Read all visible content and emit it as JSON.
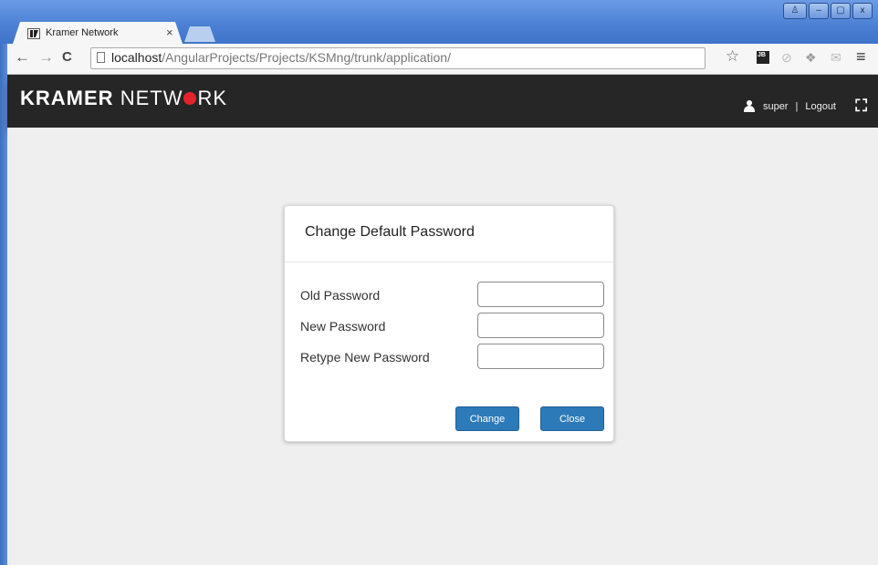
{
  "browser": {
    "tab_title": "Kramer Network",
    "tab_close": "×",
    "url_host": "localhost",
    "url_path": "/AngularProjects/Projects/KSMng/trunk/application/",
    "window_controls": {
      "profile": "♙",
      "minimize": "–",
      "maximize": "▢",
      "close": "x"
    },
    "nav": {
      "back": "←",
      "forward": "→",
      "reload": "C"
    },
    "extensions": {
      "bookmark_star": "☆",
      "jb": "JB",
      "opera": "⊘",
      "dropbox": "❖",
      "mail": "✉",
      "menu": "≡"
    }
  },
  "header": {
    "brand_bold": "KRAMER",
    "brand_light_1": "NETW",
    "brand_light_2": "RK",
    "username": "super",
    "separator": "|",
    "logout_label": "Logout",
    "fullscreen_icon": "⛶"
  },
  "dialog": {
    "title": "Change Default Password",
    "fields": [
      {
        "label": "Old Password",
        "value": ""
      },
      {
        "label": "New Password",
        "value": ""
      },
      {
        "label": "Retype New Password",
        "value": ""
      }
    ],
    "change_label": "Change",
    "close_label": "Close"
  },
  "colors": {
    "header_bg": "#262626",
    "brand_dot": "#e4222e",
    "button_bg": "#2d7ab8",
    "content_bg": "#efefef"
  }
}
